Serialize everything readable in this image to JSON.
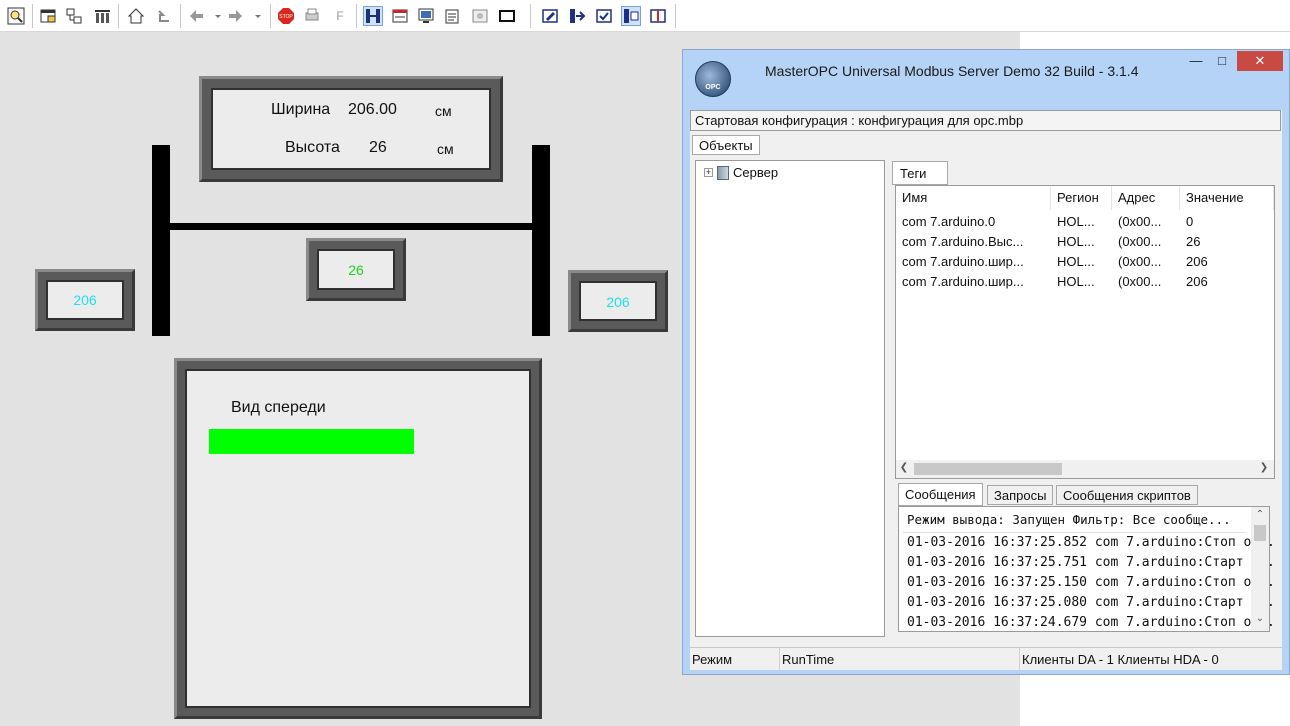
{
  "toolbar": {
    "buttons": [
      "zoom-icon",
      "window-icon",
      "network-icon",
      "tags-icon",
      "home-icon",
      "up-icon",
      "back-icon",
      "forward-icon",
      "stop-icon",
      "print-icon",
      "font-icon",
      "fit-icon",
      "panel-icon",
      "monitor-icon",
      "properties-icon",
      "image-icon",
      "rectangle-icon",
      "edit-icon",
      "export-icon",
      "check-icon",
      "select-icon",
      "book-icon"
    ],
    "stop_label": "STOP",
    "font_label": "F"
  },
  "scada": {
    "dimensions": {
      "width_label": "Ширина",
      "width_value": "206.00",
      "width_unit": "см",
      "height_label": "Высота",
      "height_value": "26",
      "height_unit": "см"
    },
    "left_value": "206",
    "center_value": "26",
    "right_value": "206",
    "front_view": {
      "label": "Вид спереди",
      "bar_color": "#00ff00"
    }
  },
  "opc_window": {
    "title": "MasterOPC Universal Modbus Server Demo 32 Build - 3.1.4",
    "logo_text": "OPC",
    "config_label": "Стартовая конфигурация : конфигурация для opc.mbp",
    "objects_tab": "Объекты",
    "tree": {
      "server": "Сервер"
    },
    "tags_tab": "Теги",
    "columns": [
      "Имя",
      "Регион",
      "Адрес",
      "Значение"
    ],
    "rows": [
      [
        "com 7.arduino.0",
        "HOL...",
        "(0x00...",
        "0"
      ],
      [
        "com 7.arduino.Выс...",
        "HOL...",
        "(0x00...",
        "26"
      ],
      [
        "com 7.arduino.шир...",
        "HOL...",
        "(0x00...",
        "206"
      ],
      [
        "com 7.arduino.шир...",
        "HOL...",
        "(0x00...",
        "206"
      ]
    ],
    "bottom_tabs": [
      "Сообщения",
      "Запросы",
      "Сообщения скриптов"
    ],
    "messages": [
      "Режим вывода: Запущен Фильтр: Все сообще...",
      "01-03-2016 16:37:25.852 com 7.arduino:Стоп о...",
      "01-03-2016 16:37:25.751 com 7.arduino:Старт ...",
      "01-03-2016 16:37:25.150 com 7.arduino:Стоп о...",
      "01-03-2016 16:37:25.080 com 7.arduino:Старт ...",
      "01-03-2016 16:37:24.679 com 7.arduino:Стоп о..."
    ],
    "status": {
      "mode_label": "Режим",
      "mode_value": "RunTime",
      "clients": "Клиенты DA - 1 Клиенты HDA - 0"
    }
  }
}
